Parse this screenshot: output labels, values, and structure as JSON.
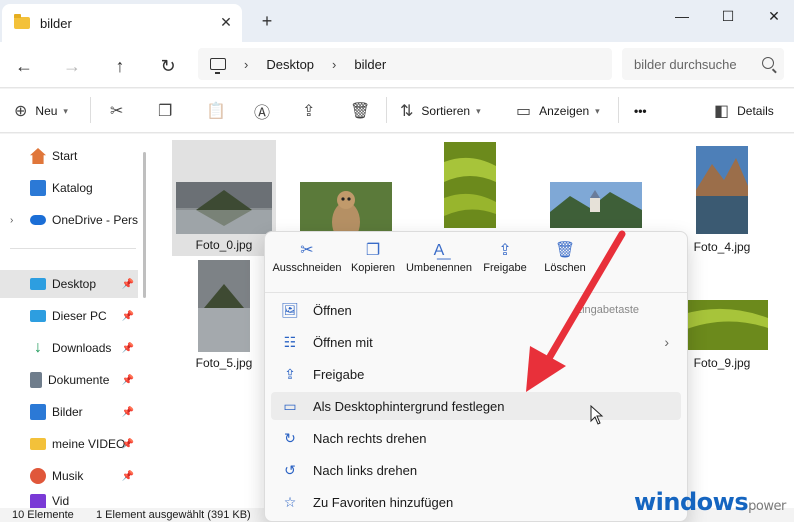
{
  "window": {
    "tab_title": "bilder",
    "close_tab": "✕",
    "new_tab": "+",
    "minimize": "—",
    "maximize": "☐",
    "close": "✕"
  },
  "nav": {
    "back": "←",
    "forward": "→",
    "up": "↑",
    "refresh": "↻",
    "crumbs": [
      "Desktop",
      "bilder"
    ],
    "crumb_sep": "›",
    "search_placeholder": "bilder durchsuche"
  },
  "toolbar": {
    "new_label": "Neu",
    "sort_label": "Sortieren",
    "view_label": "Anzeigen",
    "more_label": "•••",
    "details_label": "Details"
  },
  "sidebar": {
    "items": [
      {
        "label": "Start",
        "icon": "home-icon",
        "color": "#e0763a"
      },
      {
        "label": "Katalog",
        "icon": "gallery-icon",
        "color": "#2b79d6"
      },
      {
        "label": "OneDrive - Perso",
        "icon": "cloud-icon",
        "color": "#1b6ed6"
      },
      {
        "label": "Desktop",
        "icon": "desktop-icon",
        "color": "#2d9ee0"
      },
      {
        "label": "Dieser PC",
        "icon": "pc-icon",
        "color": "#2d9ee0"
      },
      {
        "label": "Downloads",
        "icon": "download-icon",
        "color": "#1e9a5a"
      },
      {
        "label": "Dokumente",
        "icon": "document-icon",
        "color": "#6f7d8c"
      },
      {
        "label": "Bilder",
        "icon": "pictures-icon",
        "color": "#2b79d6"
      },
      {
        "label": "meine VIDEO",
        "icon": "folder-icon",
        "color": "#f3c13a"
      },
      {
        "label": "Musik",
        "icon": "music-icon",
        "color": "#e0573a"
      },
      {
        "label": "Vid",
        "icon": "video-icon",
        "color": "#7a3ad6"
      }
    ],
    "pin": "📌"
  },
  "files": [
    {
      "name": "Foto_0.jpg",
      "selected": true
    },
    {
      "name": "",
      "selected": false
    },
    {
      "name": "",
      "selected": false
    },
    {
      "name": "",
      "selected": false
    },
    {
      "name": "Foto_4.jpg",
      "selected": false
    },
    {
      "name": "Foto_5.jpg",
      "selected": false
    },
    {
      "name": "Foto_9.jpg",
      "selected": false
    }
  ],
  "status": {
    "count": "10 Elemente",
    "selection": "1 Element ausgewählt (391 KB)"
  },
  "context_menu": {
    "quick_actions": [
      {
        "label": "Ausschneiden",
        "icon": "scissors-icon",
        "glyph": "✂"
      },
      {
        "label": "Kopieren",
        "icon": "copy-icon",
        "glyph": "❐"
      },
      {
        "label": "Umbenennen",
        "icon": "rename-icon",
        "glyph": "A͟"
      },
      {
        "label": "Freigabe",
        "icon": "share-icon",
        "glyph": "⇪"
      },
      {
        "label": "Löschen",
        "icon": "trash-icon",
        "glyph": "🗑"
      }
    ],
    "items": [
      {
        "label": "Öffnen",
        "icon": "image-icon",
        "shortcut": "Eingabetaste"
      },
      {
        "label": "Öffnen mit",
        "icon": "open-with-icon",
        "submenu": "›"
      },
      {
        "label": "Freigabe",
        "icon": "share-icon"
      },
      {
        "label": "Als Desktophintergrund festlegen",
        "icon": "wallpaper-icon",
        "hover": true
      },
      {
        "label": "Nach rechts drehen",
        "icon": "rotate-right-icon"
      },
      {
        "label": "Nach links drehen",
        "icon": "rotate-left-icon"
      },
      {
        "label": "Zu Favoriten hinzufügen",
        "icon": "star-icon"
      }
    ]
  },
  "watermark": {
    "main": "windows",
    "small": "power"
  },
  "colors": {
    "accent": "#2a62c4",
    "arrow": "#e8303a",
    "titlebar": "#e9eef5"
  }
}
